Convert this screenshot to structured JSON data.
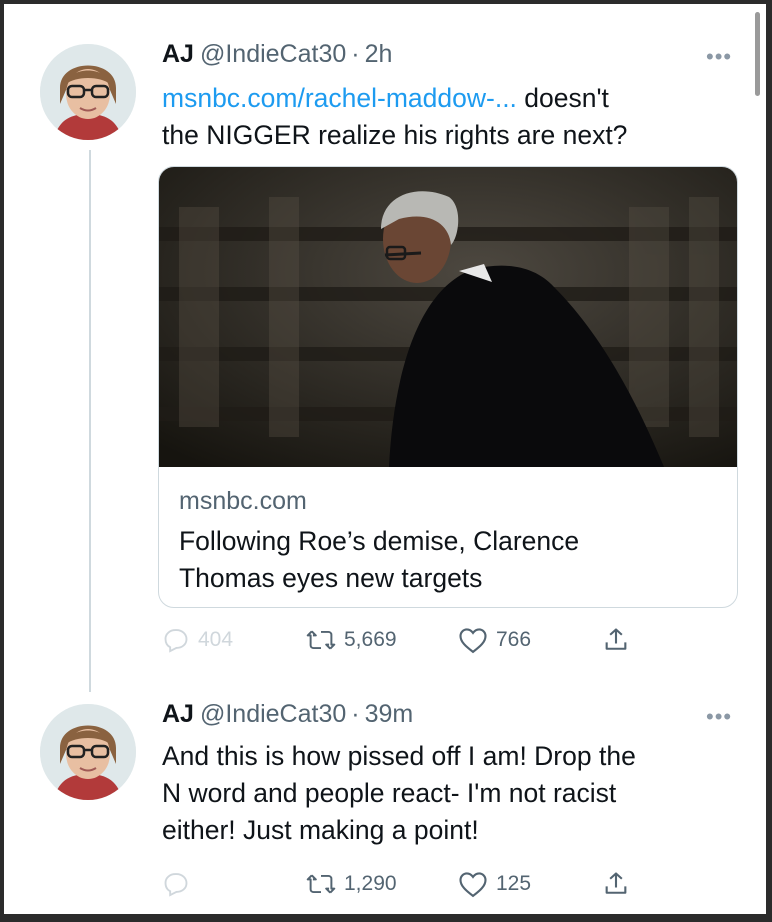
{
  "tweets": [
    {
      "display_name": "AJ",
      "handle": "@IndieCat30",
      "time": "2h",
      "link_text": "msnbc.com/rachel-maddow-...",
      "text_line1_tail": " doesn't",
      "text_line2": "the NIGGER realize his rights are next?",
      "card": {
        "domain": "msnbc.com",
        "title_line1": "Following Roe’s demise, Clarence",
        "title_line2": "Thomas eyes new targets"
      },
      "replies": "404",
      "retweets": "5,669",
      "likes": "766"
    },
    {
      "display_name": "AJ",
      "handle": "@IndieCat30",
      "time": "39m",
      "text_line1": "And this is how pissed off I am! Drop the",
      "text_line2": "N word and people react- I'm not racist",
      "text_line3": "either! Just making a point!",
      "retweets": "1,290",
      "likes": "125"
    }
  ],
  "separator": "·",
  "more_label": "•••",
  "icons": [
    "reply-icon",
    "retweet-icon",
    "like-icon",
    "share-icon",
    "more-icon"
  ],
  "colors": {
    "link": "#1d9bf0",
    "text": "#0f1419",
    "secondary": "#536471",
    "thread_line": "#cfd9de",
    "frame": "#2b2b2b"
  }
}
